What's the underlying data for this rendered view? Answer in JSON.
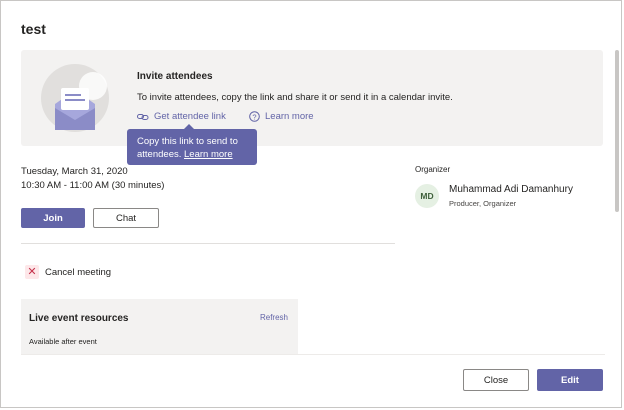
{
  "dialog": {
    "title": "test"
  },
  "invite": {
    "heading": "Invite attendees",
    "description": "To invite attendees, copy the link and share it or send it in a calendar invite.",
    "get_link_label": "Get attendee link",
    "learn_more_label": "Learn more",
    "icons": {
      "link": "link-icon",
      "help": "help-circle-icon",
      "illustration": "envelope-illustration"
    }
  },
  "tooltip": {
    "text": "Copy this link to send to attendees.",
    "learn_more": "Learn more"
  },
  "event": {
    "date": "Tuesday, March 31, 2020",
    "time": "10:30 AM - 11:00 AM (30 minutes)"
  },
  "actions": {
    "join_label": "Join",
    "chat_label": "Chat",
    "cancel_label": "Cancel meeting"
  },
  "resources": {
    "title": "Live event resources",
    "refresh_label": "Refresh",
    "status": "Available after event"
  },
  "organizer": {
    "label": "Organizer",
    "initials": "MD",
    "name": "Muhammad Adi Damanhury",
    "role": "Producer, Organizer"
  },
  "footer": {
    "close_label": "Close",
    "edit_label": "Edit"
  },
  "colors": {
    "accent": "#6264a7",
    "danger": "#c4314b"
  }
}
